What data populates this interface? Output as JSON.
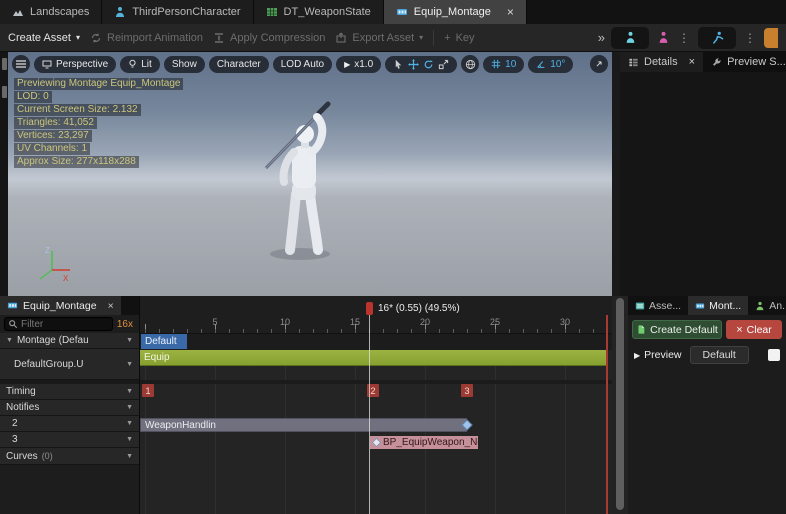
{
  "window_tabs": [
    {
      "label": "Landscapes"
    },
    {
      "label": "ThirdPersonCharacter"
    },
    {
      "label": "DT_WeaponState"
    },
    {
      "label": "Equip_Montage"
    }
  ],
  "toolbar": {
    "create_asset": "Create Asset",
    "reimport_animation": "Reimport Animation",
    "apply_compression": "Apply Compression",
    "export_asset": "Export Asset",
    "key": "Key"
  },
  "viewport": {
    "perspective": "Perspective",
    "lit": "Lit",
    "show": "Show",
    "character": "Character",
    "lod": "LOD Auto",
    "speed": "x1.0",
    "grid_snap": "10",
    "angle_snap": "10°",
    "stats": {
      "line1": "Previewing Montage Equip_Montage",
      "line2": "LOD: 0",
      "line3": "Current Screen Size: 2.132",
      "line4": "Triangles: 41,052",
      "line5": "Vertices: 23,297",
      "line6": "UV Channels: 1",
      "line7": "Approx Size: 277x118x288"
    },
    "axis_z": "Z",
    "axis_x": "X"
  },
  "details_panel": {
    "details_tab": "Details",
    "preview_tab": "Preview S..."
  },
  "bottom_left": {
    "tab": "Equip_Montage",
    "filter_placeholder": "Filter",
    "frame_rate_badge": "16x",
    "rows": [
      {
        "label": "Montage (Defau"
      },
      {
        "label": "DefaultGroup.U"
      },
      {
        "label": "Timing"
      },
      {
        "label": "Notifies"
      },
      {
        "label": "2"
      },
      {
        "label": "3"
      },
      {
        "label": "Curves"
      }
    ],
    "curves_count": "(0)"
  },
  "timeline": {
    "playhead_label": "16* (0.55) (49.5%)",
    "ticks": [
      "5",
      "10",
      "15",
      "20",
      "25",
      "30"
    ],
    "slot_label": "Default",
    "montage_bar_label": "Equip",
    "sections": [
      "1",
      "2",
      "3"
    ],
    "notify_state_label": "WeaponHandlin",
    "notify_label": "BP_EquipWeapon_Not"
  },
  "bottom_right": {
    "tabs": [
      {
        "label": "Asse..."
      },
      {
        "label": "Mont..."
      },
      {
        "label": "An..."
      }
    ],
    "create_default": "Create Default",
    "clear": "Clear",
    "preview": "Preview",
    "default": "Default"
  }
}
